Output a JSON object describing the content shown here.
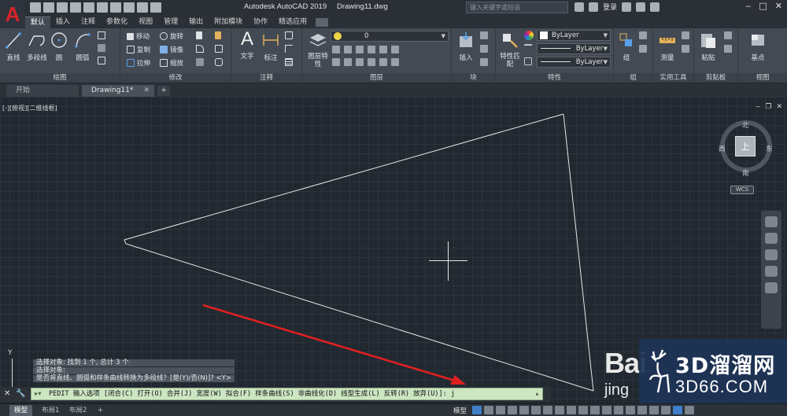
{
  "app": {
    "title": "Autodesk AutoCAD 2019",
    "file": "Drawing11.dwg",
    "logo_letter": "A",
    "search_placeholder": "键入关键字或短语",
    "login": "登录"
  },
  "ribbon_tabs": [
    "默认",
    "插入",
    "注释",
    "参数化",
    "视图",
    "管理",
    "输出",
    "附加模块",
    "协作",
    "精选应用"
  ],
  "panels": {
    "draw": {
      "title": "绘图",
      "tools": [
        "直线",
        "多段线",
        "圆",
        "圆弧"
      ]
    },
    "modify": {
      "title": "修改",
      "tools": [
        "移动",
        "旋转",
        "复制",
        "镜像",
        "拉伸",
        "缩放"
      ]
    },
    "annotation": {
      "title": "注释",
      "tools": [
        "文字",
        "标注"
      ]
    },
    "layers": {
      "title": "图层",
      "tools": [
        "图层特性"
      ],
      "layer_value": "0"
    },
    "block": {
      "title": "块",
      "tools": [
        "插入"
      ]
    },
    "properties": {
      "title": "特性",
      "tools": [
        "特性匹配"
      ],
      "color": "ByLayer",
      "linetype": "ByLayer",
      "lineweight": "ByLayer"
    },
    "group": {
      "title": "组",
      "tools": [
        "组"
      ]
    },
    "utilities": {
      "title": "实用工具",
      "tools": [
        "测量"
      ]
    },
    "clipboard": {
      "title": "剪贴板",
      "tools": [
        "粘贴"
      ]
    },
    "view": {
      "title": "视图",
      "tools": [
        "基点"
      ]
    }
  },
  "file_tabs": [
    "开始",
    "Drawing11*"
  ],
  "viewport": {
    "label": "[-][俯视][二维线框]",
    "viewcube": {
      "top": "上",
      "north": "北",
      "south": "南",
      "east": "东",
      "west": "西",
      "wcs": "WCS"
    }
  },
  "command_history": [
    "选择对象: 找到 1 个, 总计 3 个",
    "选择对象:",
    "是否将直线、圆弧和样条曲线转换为多段线？[是(Y)/否(N)]? <Y>"
  ],
  "command_line": {
    "text": "PEDIT 输入选项 [闭合(C) 打开(O) 合并(J) 宽度(W) 拟合(F) 样条曲线(S) 非曲线化(D) 线型生成(L) 反转(R) 放弃(U)]: j"
  },
  "layout_tabs": [
    "模型",
    "布局1",
    "布局2"
  ],
  "status": {
    "model_label": "模型"
  },
  "watermark": {
    "brand": "Bai",
    "sub": "jing",
    "cn": "3D溜溜网",
    "url": "3D66.COM"
  },
  "colors": {
    "accent": "#d8232a",
    "canvas": "#212830",
    "command_bg": "#cde6c2",
    "arrow": "#e02020"
  }
}
